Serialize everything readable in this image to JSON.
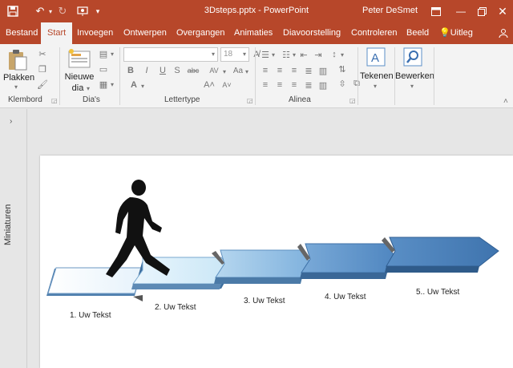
{
  "titlebar": {
    "title": "3Dsteps.pptx  -  PowerPoint",
    "user": "Peter DeSmet"
  },
  "tabs": [
    {
      "label": "Bestand"
    },
    {
      "label": "Start"
    },
    {
      "label": "Invoegen"
    },
    {
      "label": "Ontwerpen"
    },
    {
      "label": "Overgangen"
    },
    {
      "label": "Animaties"
    },
    {
      "label": "Diavoorstelling"
    },
    {
      "label": "Controleren"
    },
    {
      "label": "Beeld"
    },
    {
      "label": "Uitleg"
    }
  ],
  "ribbon": {
    "paste_label": "Plakken",
    "new_slide_label_1": "Nieuwe",
    "new_slide_label_2": "dia",
    "font_size_value": "18",
    "draw_label": "Tekenen",
    "edit_label": "Bewerken",
    "groups": {
      "clipboard": "Klembord",
      "slides": "Dia's",
      "font": "Lettertype",
      "paragraph": "Alinea"
    }
  },
  "thumbnails_label": "Miniaturen",
  "slide": {
    "steps": [
      {
        "label": "1. Uw Tekst"
      },
      {
        "label": "2. Uw Tekst"
      },
      {
        "label": "3. Uw Tekst"
      },
      {
        "label": "4. Uw Tekst"
      },
      {
        "label": "5.. Uw Tekst"
      }
    ]
  },
  "colors": {
    "accent": "#b7472a",
    "step_light": "#e8f3fb",
    "step_dark": "#4a7fb5"
  }
}
